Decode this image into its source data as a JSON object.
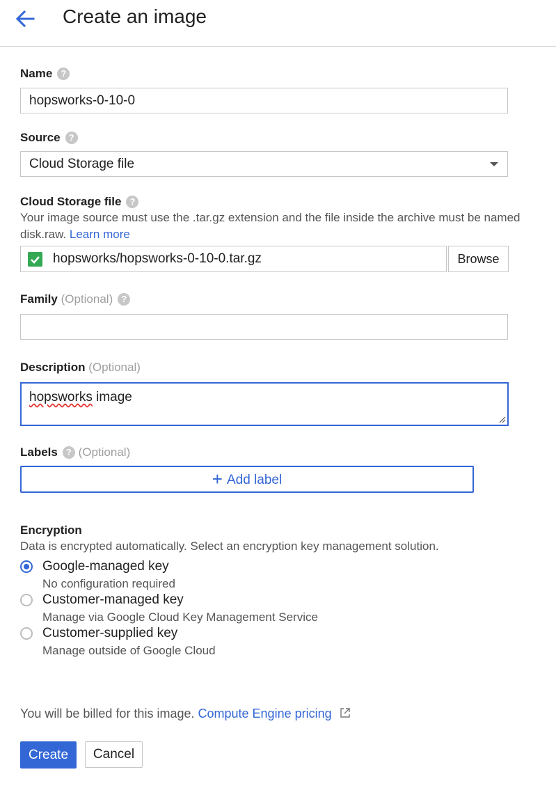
{
  "header": {
    "title": "Create an image"
  },
  "name": {
    "label": "Name",
    "value": "hopsworks-0-10-0"
  },
  "source": {
    "label": "Source",
    "selected": "Cloud Storage file"
  },
  "storage": {
    "label": "Cloud Storage file",
    "hint": "Your image source must use the .tar.gz extension and the file inside the archive must be named disk.raw.",
    "learn_more": "Learn more",
    "file": "hopsworks/hopsworks-0-10-0.tar.gz",
    "browse": "Browse"
  },
  "family": {
    "label": "Family",
    "optional": "(Optional)",
    "value": ""
  },
  "description": {
    "label": "Description",
    "optional": "(Optional)",
    "value": "hopsworks image",
    "misspelled": "hopsworks",
    "rest": " image"
  },
  "labels": {
    "label": "Labels",
    "optional": "(Optional)",
    "add": "Add label"
  },
  "encryption": {
    "label": "Encryption",
    "hint": "Data is encrypted automatically. Select an encryption key management solution.",
    "options": [
      {
        "label": "Google-managed key",
        "sub": "No configuration required",
        "selected": true
      },
      {
        "label": "Customer-managed key",
        "sub": "Manage via Google Cloud Key Management Service",
        "selected": false
      },
      {
        "label": "Customer-supplied key",
        "sub": "Manage outside of Google Cloud",
        "selected": false
      }
    ]
  },
  "billing": {
    "text": "You will be billed for this image.",
    "link": "Compute Engine pricing"
  },
  "actions": {
    "create": "Create",
    "cancel": "Cancel"
  },
  "colors": {
    "accent": "#3367d6",
    "check": "#34a853"
  }
}
